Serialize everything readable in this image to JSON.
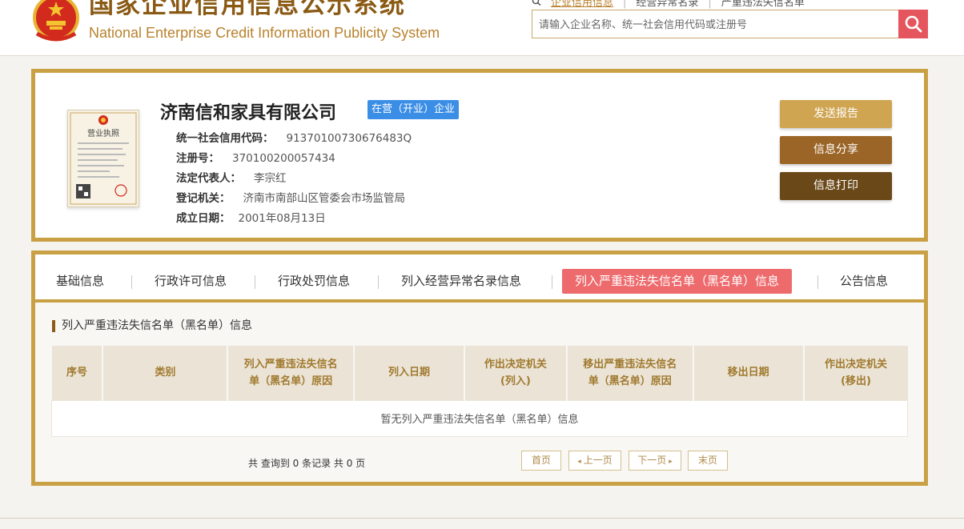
{
  "header": {
    "title": "国家企业信用信息公示系统",
    "subtitle": "National Enterprise Credit Information Publicity System",
    "top_links": [
      "企业信用信息",
      "经营异常名录",
      "严重违法失信名单"
    ],
    "search_placeholder": "请输入企业名称、统一社会信用代码或注册号"
  },
  "company": {
    "name": "济南信和家具有限公司",
    "status": "在营（开业）企业",
    "fields": [
      {
        "label": "统一社会信用代码：",
        "value": "91370100730676483Q"
      },
      {
        "label": "注册号：",
        "value": "370100200057434"
      },
      {
        "label": "法定代表人：",
        "value": "李宗红"
      },
      {
        "label": "登记机关：",
        "value": "济南市南部山区管委会市场监管局"
      },
      {
        "label": "成立日期：",
        "value": "2001年08月13日"
      }
    ],
    "license_title": "营业执照"
  },
  "actions": {
    "send_report": "发送报告",
    "share": "信息分享",
    "print": "信息打印"
  },
  "tabs": [
    {
      "label": "基础信息",
      "active": false
    },
    {
      "label": "行政许可信息",
      "active": false
    },
    {
      "label": "行政处罚信息",
      "active": false
    },
    {
      "label": "列入经营异常名录信息",
      "active": false
    },
    {
      "label": "列入严重违法失信名单（黑名单）信息",
      "active": true
    },
    {
      "label": "公告信息",
      "active": false
    }
  ],
  "section": {
    "title": "列入严重违法失信名单（黑名单）信息",
    "columns": [
      [
        "序号"
      ],
      [
        "类别"
      ],
      [
        "列入严重违法失信名",
        "单（黑名单）原因"
      ],
      [
        "列入日期"
      ],
      [
        "作出决定机关",
        "(列入)"
      ],
      [
        "移出严重违法失信名",
        "单（黑名单）原因"
      ],
      [
        "移出日期"
      ],
      [
        "作出决定机关",
        "(移出)"
      ]
    ],
    "empty_text": "暂无列入严重违法失信名单（黑名单）信息",
    "total_text": "共 查询到 0 条记录 共 0 页"
  },
  "pager": {
    "first": "首页",
    "prev": "上一页",
    "next": "下一页",
    "last": "末页"
  },
  "colors": {
    "gold": "#c9a144",
    "brown_title": "#8a5a14",
    "badge_blue": "#3b8ee6",
    "tab_active": "#ed6a6d",
    "btn_report": "#cfa552",
    "btn_share": "#9b6527",
    "btn_print": "#6a4818",
    "search_red": "#e5555e"
  },
  "icons": {
    "emblem": "national-emblem-icon",
    "search": "search-icon",
    "license": "business-license-icon"
  }
}
